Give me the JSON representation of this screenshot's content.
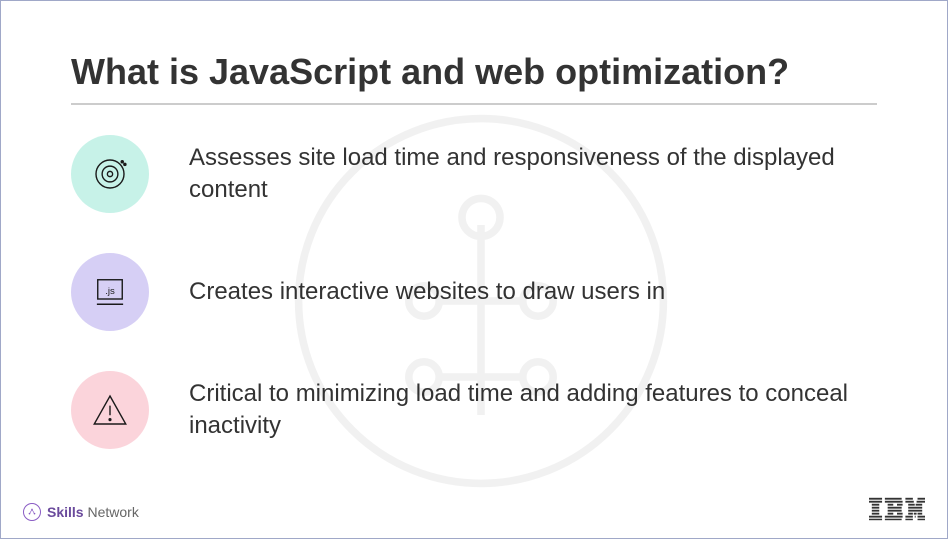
{
  "title": "What is JavaScript and web optimization?",
  "bullets": [
    {
      "text": "Assesses site load time and responsiveness of the displayed content",
      "iconColor": "#c7f2e8"
    },
    {
      "text": "Creates interactive websites to draw users in",
      "iconColor": "#d6cff5"
    },
    {
      "text": "Critical to minimizing load time and adding features to conceal inactivity",
      "iconColor": "#fbd4db"
    }
  ],
  "footer": {
    "skills": "Skills",
    "network": "Network",
    "brand": "IBM"
  }
}
